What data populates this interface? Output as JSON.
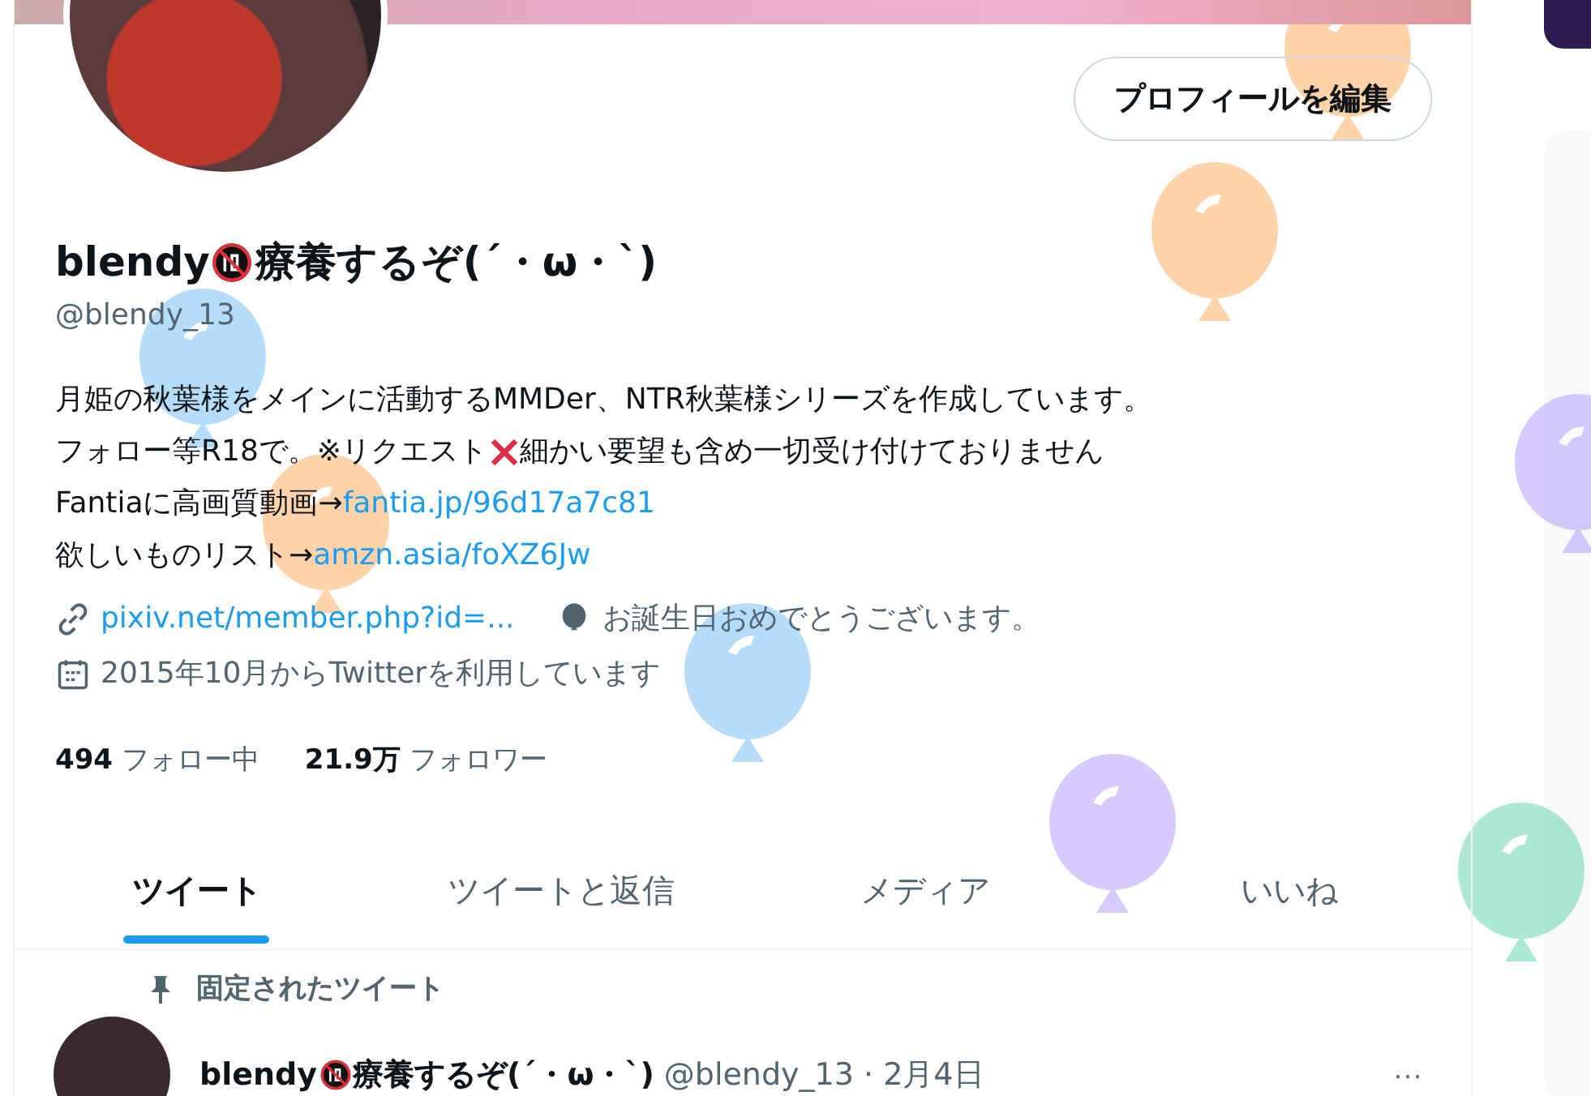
{
  "profile": {
    "edit_button": "プロフィールを編集",
    "name_before": "blendy",
    "name_after": "療養するぞ(´・ω・`)",
    "handle": "@blendy_13",
    "bio": [
      [
        {
          "kind": "text",
          "text": "月姫の秋葉様をメインに活動するMMDer、NTR秋葉様シリーズを作成しています。"
        }
      ],
      [
        {
          "kind": "text",
          "text": "フォロー等R18で。※リクエスト"
        },
        {
          "kind": "cross"
        },
        {
          "kind": "text",
          "text": "細かい要望も含め一切受け付けておりません"
        }
      ],
      [
        {
          "kind": "text",
          "text": " Fantiaに高画質動画→"
        },
        {
          "kind": "link",
          "text": "fantia.jp/96d17a7c81"
        }
      ],
      [
        {
          "kind": "text",
          "text": "欲しいものリスト→"
        },
        {
          "kind": "link",
          "text": "amzn.asia/foXZ6Jw"
        }
      ]
    ],
    "website": "pixiv.net/member.php?id=...",
    "birthday": "お誕生日おめでとうございます。",
    "joined": "2015年10月からTwitterを利用しています",
    "following_count": "494",
    "following_label": "フォロー中",
    "followers_count": "21.9万",
    "followers_label": "フォロワー"
  },
  "tabs": [
    {
      "label": "ツイート",
      "selected": true
    },
    {
      "label": "ツイートと返信",
      "selected": false
    },
    {
      "label": "メディア",
      "selected": false
    },
    {
      "label": "いいね",
      "selected": false
    }
  ],
  "pinned": {
    "label": "固定されたツイート",
    "name_before": "blendy",
    "name_after": "療養するぞ(´・ω・`)",
    "handle": "@blendy_13",
    "separator": "·",
    "date": "2月4日",
    "more": "···"
  }
}
